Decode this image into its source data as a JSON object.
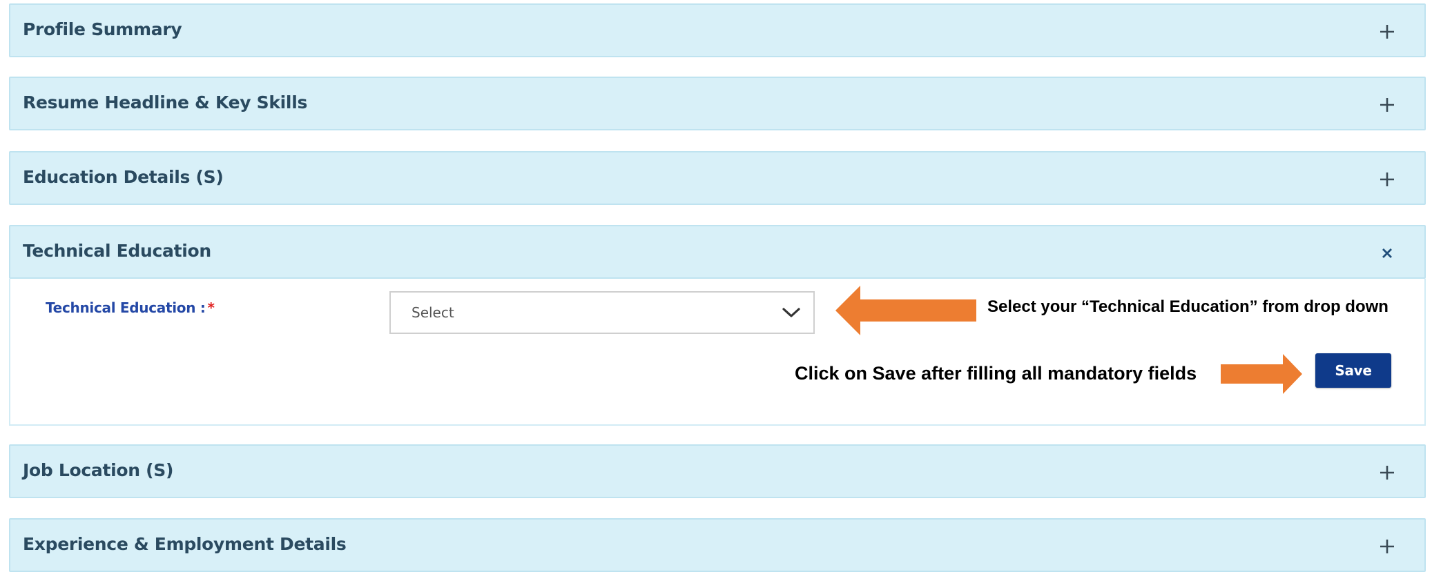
{
  "panels": [
    {
      "title": "Profile Summary",
      "state": "collapsed",
      "toggle_icon": "plus-icon"
    },
    {
      "title": "Resume Headline & Key Skills",
      "state": "collapsed",
      "toggle_icon": "plus-icon"
    },
    {
      "title": "Education Details (S)",
      "state": "collapsed",
      "toggle_icon": "plus-icon"
    },
    {
      "title": "Technical Education",
      "state": "expanded",
      "toggle_icon": "close-icon"
    },
    {
      "title": "Job Location (S)",
      "state": "collapsed",
      "toggle_icon": "plus-icon"
    },
    {
      "title": "Experience & Employment Details",
      "state": "collapsed",
      "toggle_icon": "plus-icon"
    }
  ],
  "technical_education": {
    "field_label": "Technical Education :",
    "required_marker": "*",
    "select_value": "Select",
    "save_label": "Save"
  },
  "annotations": {
    "select_hint": "Select your “Technical Education” from drop down",
    "save_hint": "Click on Save after filling all mandatory fields"
  },
  "colors": {
    "header_bg": "#d8f0f8",
    "header_border": "#bfe3f0",
    "title_text": "#2a4a60",
    "label_text": "#2448a6",
    "required": "#e02020",
    "save_button": "#0f3a8a",
    "arrow": "#ed7d31"
  }
}
